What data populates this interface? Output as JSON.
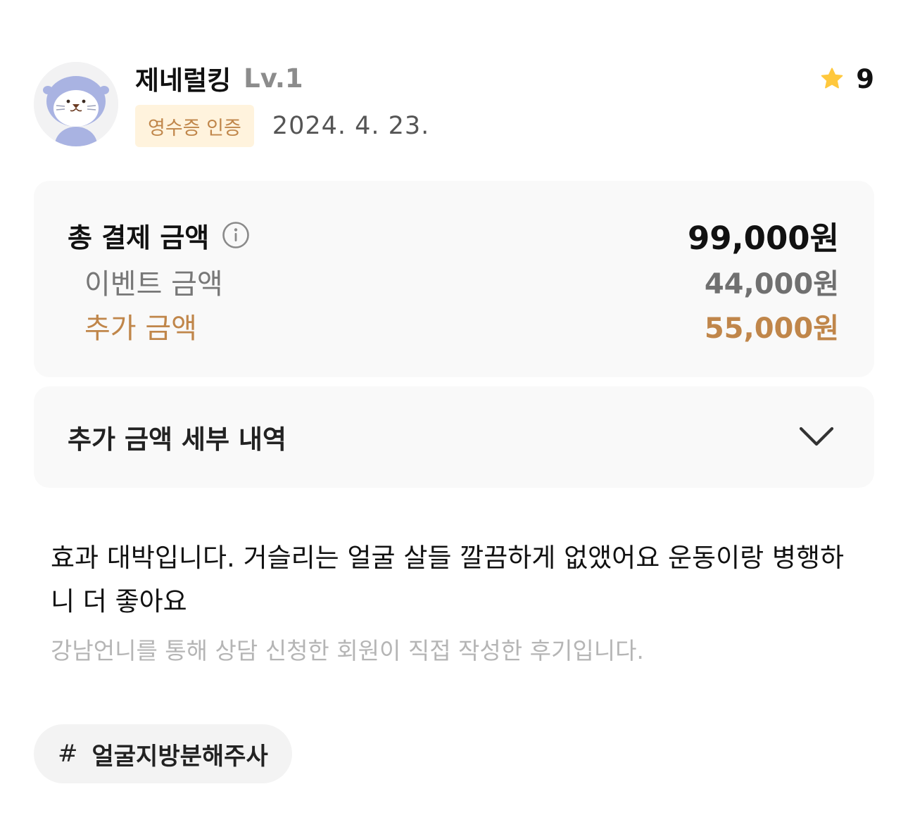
{
  "header": {
    "username": "제네럴킹",
    "level": "Lv.1",
    "receipt_badge": "영수증 인증",
    "date": "2024. 4. 23.",
    "rating": "9"
  },
  "price_summary": {
    "total_label": "총 결제 금액",
    "total_amount": "99,000원",
    "event_label": "이벤트 금액",
    "event_amount": "44,000원",
    "extra_label": "추가 금액",
    "extra_amount": "55,000원"
  },
  "detail_toggle": {
    "label": "추가 금액 세부 내역"
  },
  "review": {
    "text": "효과 대박입니다. 거슬리는 얼굴 살들 깔끔하게 없앴어요 운동이랑 병행하니 더 좋아요",
    "disclaimer": "강남언니를 통해 상담 신청한 회원이 직접 작성한 후기입니다."
  },
  "hashtags": [
    {
      "symbol": "#",
      "label": "얼굴지방분해주사"
    }
  ],
  "colors": {
    "accent_brown": "#c0864a",
    "badge_bg": "#fff3dd",
    "star": "#ffc83d",
    "card_bg": "#f9f9f9",
    "chip_bg": "#f3f3f3"
  },
  "icons": {
    "avatar": "otter-avatar-icon",
    "rating": "star-icon",
    "info": "info-icon",
    "toggle": "chevron-down-icon"
  }
}
